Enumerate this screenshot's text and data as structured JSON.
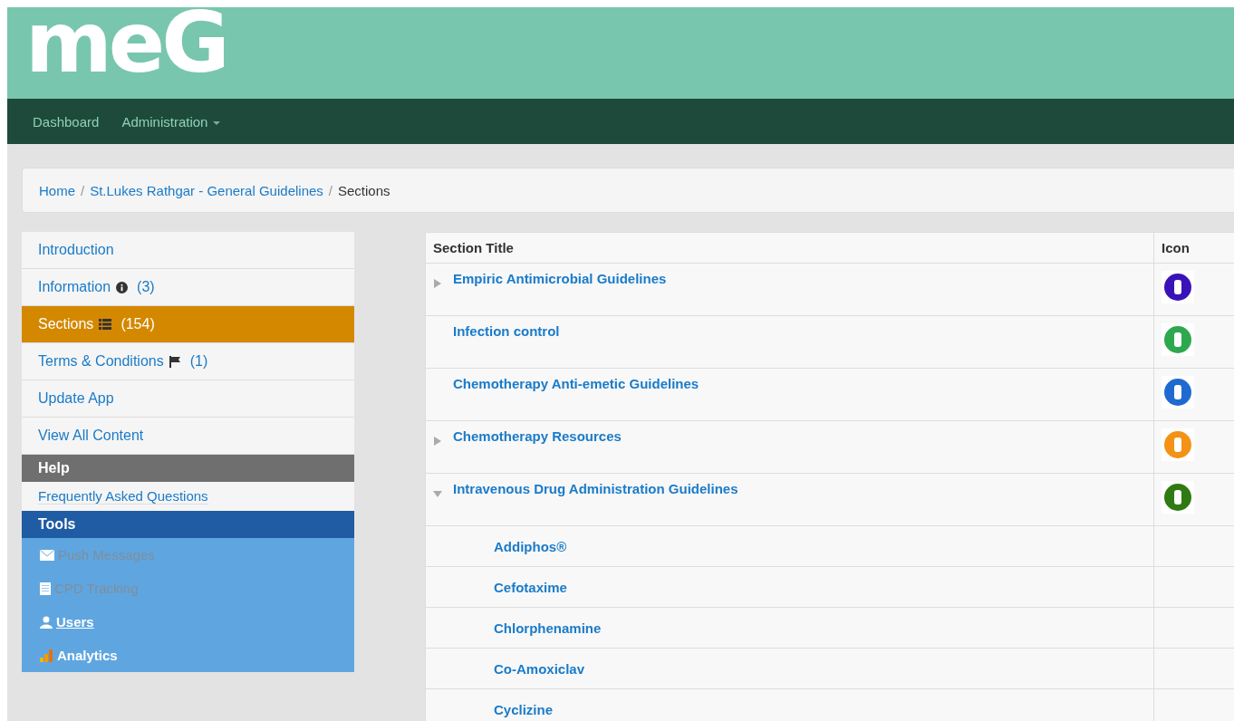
{
  "logo": "meG",
  "nav": [
    {
      "label": "Dashboard",
      "dropdown": false
    },
    {
      "label": "Administration",
      "dropdown": true
    }
  ],
  "breadcrumb": [
    "Home",
    "St.Lukes Rathgar - General Guidelines",
    "Sections"
  ],
  "breadcrumb_separators": [
    "/",
    "/"
  ],
  "sidebar": [
    {
      "kind": "link",
      "label": "Introduction",
      "selected": false
    },
    {
      "kind": "link",
      "label": "Information",
      "count": "(3)",
      "selected": false
    },
    {
      "kind": "link",
      "label": "Sections",
      "count": "(154)",
      "selected": true
    },
    {
      "kind": "link",
      "label": "Terms & Conditions",
      "count": "(1)",
      "selected": false
    },
    {
      "kind": "link",
      "label": "Update App",
      "selected": false
    },
    {
      "kind": "link",
      "label": "View All Content",
      "selected": false
    },
    {
      "kind": "header",
      "label": "Help",
      "color": "#6f6f6f"
    },
    {
      "kind": "small",
      "label": "Frequently Asked Questions"
    },
    {
      "kind": "header",
      "label": "Tools",
      "color": "#1f5ca3"
    },
    {
      "kind": "tool",
      "label": "Push Messages",
      "disabled": true
    },
    {
      "kind": "tool",
      "label": "CPD Tracking",
      "disabled": true
    },
    {
      "kind": "tool",
      "label": "Users",
      "disabled": false
    },
    {
      "kind": "tool",
      "label": "Analytics",
      "disabled": false
    }
  ],
  "table": {
    "columns": [
      "Section Title",
      "Icon"
    ],
    "rows": [
      {
        "title": "Empiric Antimicrobial Guidelines",
        "expanded": false,
        "color": "#3a13b8"
      },
      {
        "title": "Infection control",
        "color": "#2ea84f"
      },
      {
        "title": "Chemotherapy Anti-emetic Guidelines",
        "color": "#1f6ad0"
      },
      {
        "title": "Chemotherapy Resources",
        "expanded": false,
        "color": "#f39214"
      },
      {
        "title": "Intravenous Drug Administration Guidelines",
        "expanded": true,
        "color": "#2f7a12",
        "children": [
          {
            "title": "Addiphos®"
          },
          {
            "title": "Cefotaxime"
          },
          {
            "title": "Chlorphenamine"
          },
          {
            "title": "Co-Amoxiclav"
          },
          {
            "title": "Cyclizine"
          }
        ]
      }
    ]
  }
}
